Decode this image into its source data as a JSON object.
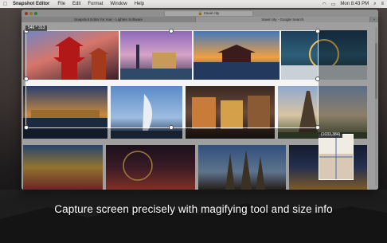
{
  "menubar": {
    "app_name": "Snapshot Editor",
    "items": [
      "File",
      "Edit",
      "Format",
      "Window",
      "Help"
    ],
    "clock": "Mon 8:43 PM"
  },
  "browser": {
    "window_title": "Snapshot Editor for mac - Lighten Software",
    "address": "travel city",
    "tabs": [
      "Snapshot Editor for mac - Lighten Software",
      "travel city - Google Search"
    ]
  },
  "capture": {
    "size_label": "546 * 313",
    "coord_label": "(1033,384)"
  },
  "caption": "Capture screen precisely with magifying tool and size info",
  "colors": {
    "menubar": "#e9e7e5",
    "overlay": "rgba(0,0,0,0.35)",
    "selection_border": "#ffffff"
  }
}
